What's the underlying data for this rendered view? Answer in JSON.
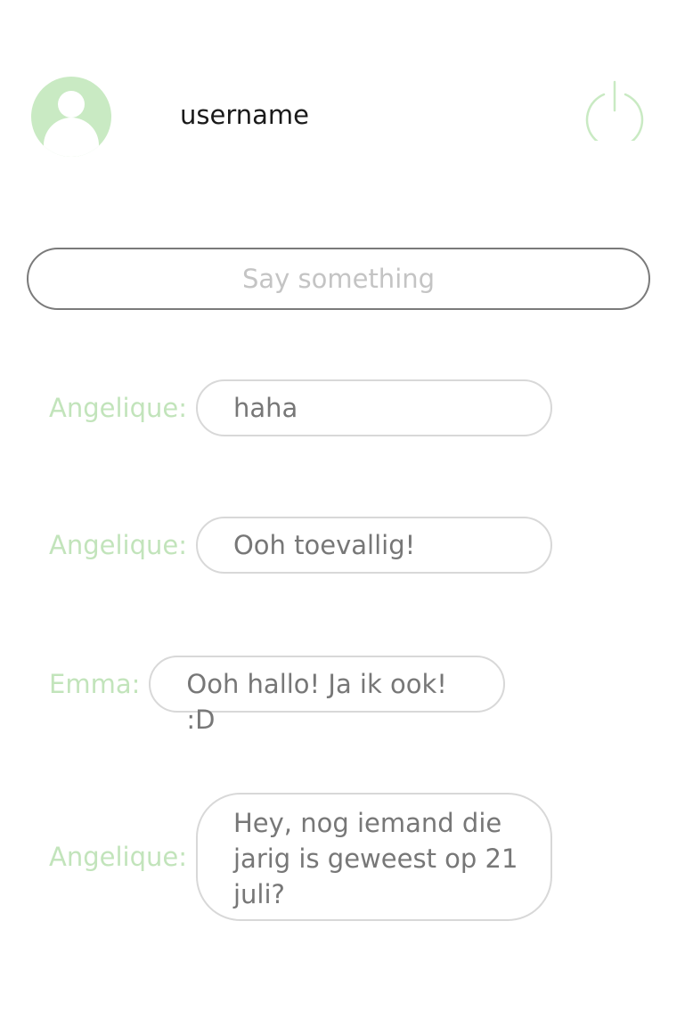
{
  "header": {
    "username": "username",
    "avatar_icon": "user-avatar-icon",
    "power_icon": "power-icon",
    "accent_color": "#c9eac3"
  },
  "composer": {
    "placeholder": "Say something",
    "value": ""
  },
  "messages": [
    {
      "sender": "Angelique:",
      "text": "haha"
    },
    {
      "sender": "Angelique:",
      "text": "Ooh toevallig!"
    },
    {
      "sender": "Emma:",
      "text": "Ooh hallo! Ja ik ook! :D"
    },
    {
      "sender": "Angelique:",
      "text": "Hey, nog iemand die jarig is geweest op 21 juli?"
    }
  ]
}
